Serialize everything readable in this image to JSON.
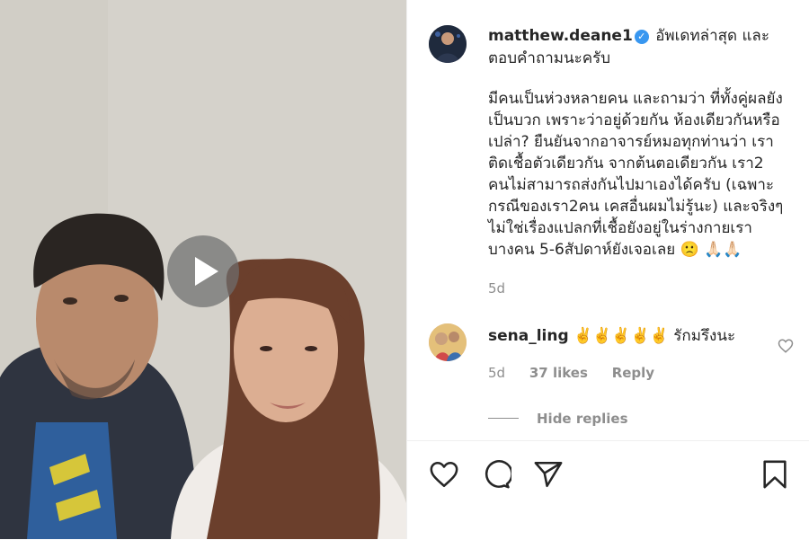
{
  "post": {
    "username": "matthew.deane1",
    "verified_icon": "verified-badge-icon",
    "caption_head": "อัพเดทล่าสุด และตอบคำถามนะครับ",
    "caption_body": "มีคนเป็นห่วงหลายคน และถามว่า ที่ทั้งคู่ผลยัง\nเป็นบวก เพราะว่าอยู่ด้วยกัน ห้องเดียวกันหรือ\nเปล่า? ยืนยันจากอาจารย์หมอทุกท่านว่า เรา\nติดเชื้อตัวเดียวกัน จากต้นตอเดียวกัน เรา2\nคนไม่สามารถส่งกันไปมาเองได้ครับ (เฉพาะ\nกรณีของเรา2คน เคสอื่นผมไม่รู้นะ) และจริงๆ\nไม่ใช่เรื่องแปลกที่เชื้อยังอยู่ในร่างกายเรา\nบางคน 5-6สัปดาห์ยังเจอเลย 🙁 🙏🏻🙏🏻",
    "age": "5d"
  },
  "comment": {
    "username": "sena_ling",
    "text": "✌️✌️✌️✌️✌️ รักมรึงนะ",
    "age": "5d",
    "likes": "37 likes",
    "reply_label": "Reply",
    "hide_replies_label": "Hide replies"
  },
  "actions": {
    "like_icon": "heart-icon",
    "comment_icon": "comment-icon",
    "share_icon": "paper-plane-icon",
    "save_icon": "bookmark-icon"
  },
  "video": {
    "play_icon": "play-icon"
  },
  "colors": {
    "accent_blue": "#3897f0",
    "text": "#262626",
    "muted": "#8e8e8e"
  }
}
